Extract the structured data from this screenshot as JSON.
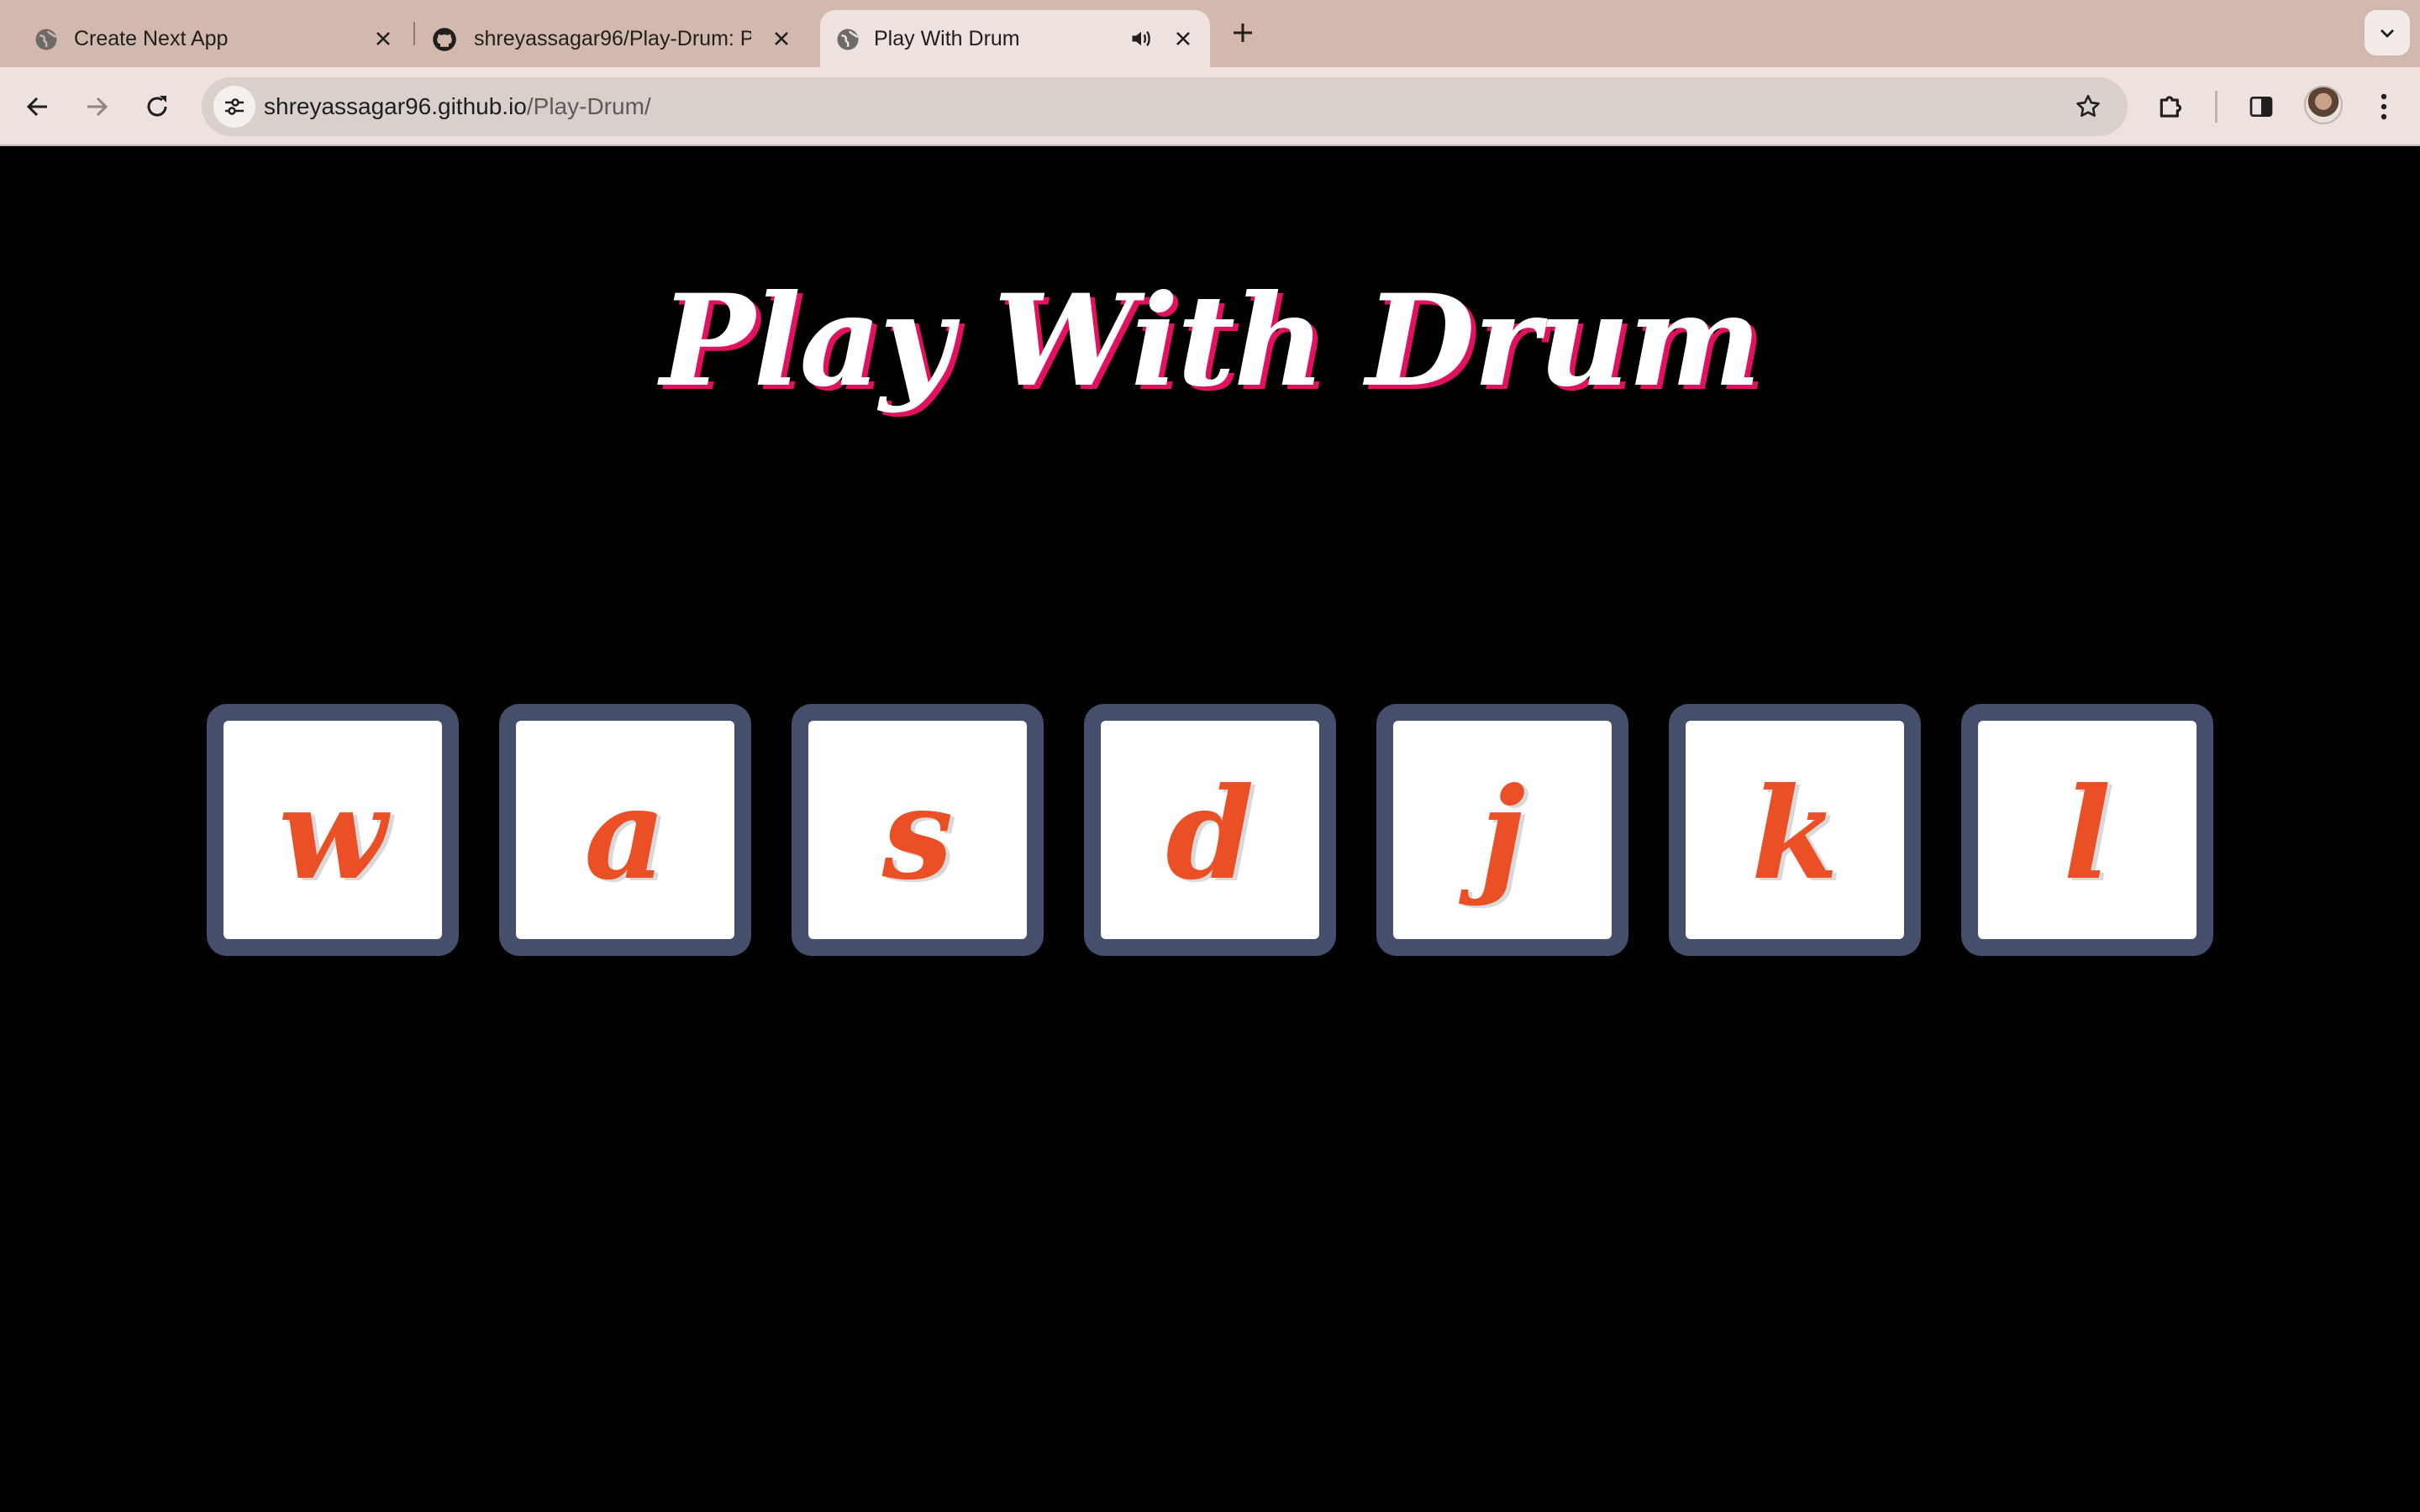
{
  "browser": {
    "tabs": [
      {
        "title": "Create Next App",
        "icon": "globe-icon",
        "active": false
      },
      {
        "title": "shreyassagar96/Play-Drum: P",
        "icon": "github-icon",
        "active": false
      },
      {
        "title": "Play With Drum",
        "icon": "globe-icon",
        "active": true,
        "audio": true
      }
    ],
    "url_domain": "shreyassagar96.github.io",
    "url_path": "/Play-Drum/"
  },
  "page": {
    "heading": "Play With Drum",
    "keys": [
      "w",
      "a",
      "s",
      "d",
      "j",
      "k",
      "l"
    ]
  },
  "colors": {
    "heading_shadow": "#e0115f",
    "key_letter": "#ea4f25",
    "key_frame": "#454e6b",
    "background": "#000000"
  }
}
